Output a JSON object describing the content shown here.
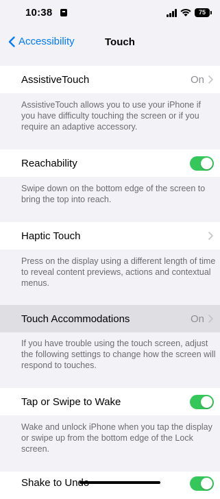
{
  "status_bar": {
    "time": "10:38",
    "battery": "75"
  },
  "nav": {
    "back_label": "Accessibility",
    "title": "Touch"
  },
  "rows": [
    {
      "label": "AssistiveTouch",
      "value": "On",
      "control": "chevron",
      "description": "AssistiveTouch allows you to use your iPhone if you have difficulty touching the screen or if you require an adaptive accessory."
    },
    {
      "label": "Reachability",
      "control": "toggle",
      "state": "on",
      "description": "Swipe down on the bottom edge of the screen to bring the top into reach."
    },
    {
      "label": "Haptic Touch",
      "control": "chevron",
      "description": "Press on the display using a different length of time to reveal content previews, actions and contextual menus."
    },
    {
      "label": "Touch Accommodations",
      "value": "On",
      "control": "chevron",
      "highlighted": true,
      "description": "If you have trouble using the touch screen, adjust the following settings to change how the screen will respond to touches."
    },
    {
      "label": "Tap or Swipe to Wake",
      "control": "toggle",
      "state": "on",
      "description": "Wake and unlock iPhone when you tap the display or swipe up from the bottom edge of the Lock screen."
    },
    {
      "label": "Shake to Undo",
      "control": "toggle",
      "state": "on"
    }
  ],
  "colors": {
    "accent": "#007aff",
    "toggle_on": "#34c759",
    "background": "#f2f2f7",
    "secondary_text": "#6c6c70"
  }
}
